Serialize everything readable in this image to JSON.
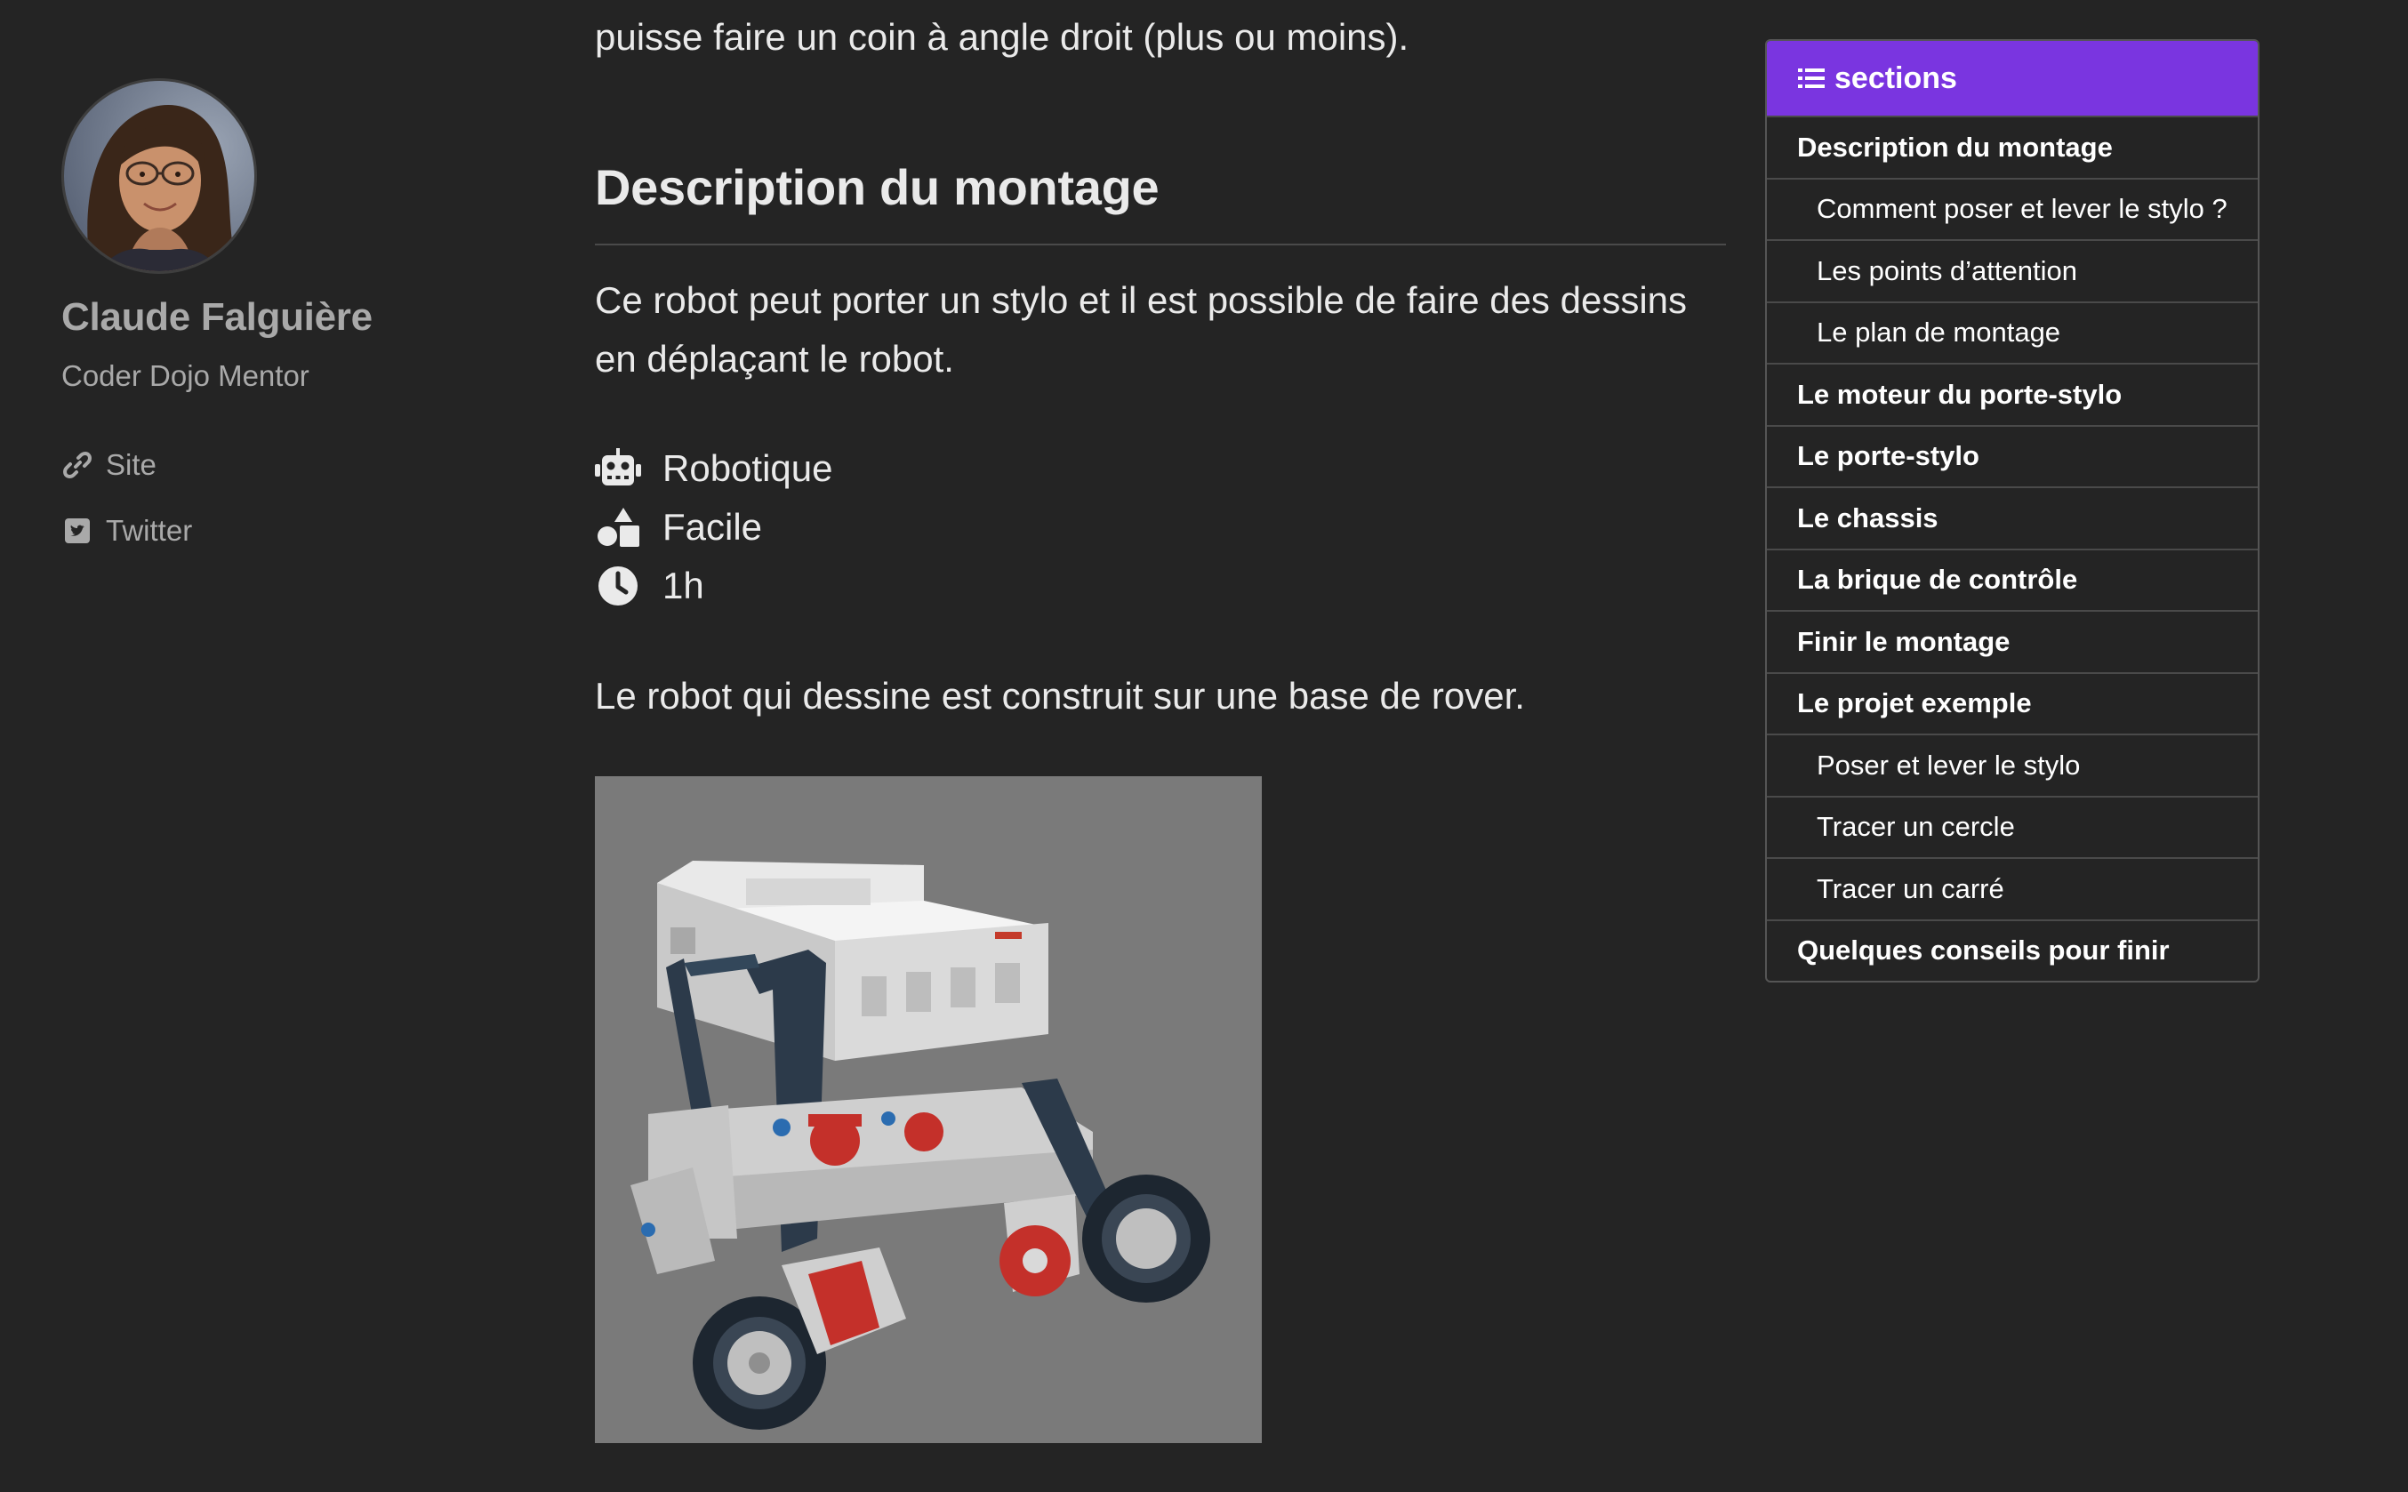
{
  "author": {
    "name": "Claude Falguière",
    "role": "Coder Dojo Mentor",
    "links": [
      {
        "label": "Site",
        "icon": "link-icon"
      },
      {
        "label": "Twitter",
        "icon": "twitter-icon"
      }
    ]
  },
  "article": {
    "intro_tail": "puisse faire un coin à angle droit (plus ou moins).",
    "section_heading": "Description du montage",
    "description": "Ce robot peut porter un stylo et il est possible de faire des dessins en déplaçant le robot.",
    "meta": {
      "category": "Robotique",
      "difficulty": "Facile",
      "duration": "1h"
    },
    "rover_sentence": "Le robot qui dessine est construit sur une base de rover."
  },
  "toc": {
    "title": "sections",
    "accent_color": "#7a35e0",
    "items": [
      {
        "label": "Description du montage",
        "level": 1
      },
      {
        "label": "Comment poser et lever le stylo ?",
        "level": 2
      },
      {
        "label": "Les points d’attention",
        "level": 2
      },
      {
        "label": "Le plan de montage",
        "level": 2
      },
      {
        "label": "Le moteur du porte-stylo",
        "level": 1
      },
      {
        "label": "Le porte-stylo",
        "level": 1
      },
      {
        "label": "Le chassis",
        "level": 1
      },
      {
        "label": "La brique de contrôle",
        "level": 1
      },
      {
        "label": "Finir le montage",
        "level": 1
      },
      {
        "label": "Le projet exemple",
        "level": 1
      },
      {
        "label": "Poser et lever le stylo",
        "level": 2
      },
      {
        "label": "Tracer un cercle",
        "level": 2
      },
      {
        "label": "Tracer un carré",
        "level": 2
      },
      {
        "label": "Quelques conseils pour finir",
        "level": 1
      }
    ]
  }
}
